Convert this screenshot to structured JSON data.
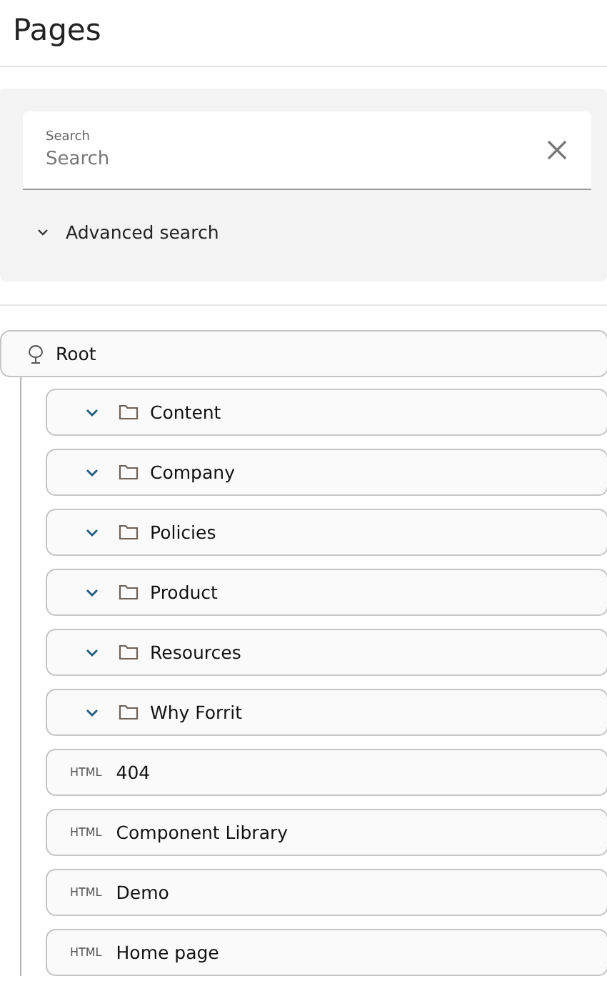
{
  "header": {
    "title": "Pages"
  },
  "search": {
    "label": "Search",
    "placeholder": "Search",
    "advanced_label": "Advanced search"
  },
  "tree": {
    "label": "Root",
    "children": [
      {
        "kind": "folder",
        "label": "Content"
      },
      {
        "kind": "folder",
        "label": "Company"
      },
      {
        "kind": "folder",
        "label": "Policies"
      },
      {
        "kind": "folder",
        "label": "Product"
      },
      {
        "kind": "folder",
        "label": "Resources"
      },
      {
        "kind": "folder",
        "label": "Why Forrit"
      },
      {
        "kind": "page",
        "type_label": "HTML",
        "label": "404"
      },
      {
        "kind": "page",
        "type_label": "HTML",
        "label": "Component Library"
      },
      {
        "kind": "page",
        "type_label": "HTML",
        "label": "Demo"
      },
      {
        "kind": "page",
        "type_label": "HTML",
        "label": "Home page"
      }
    ]
  }
}
